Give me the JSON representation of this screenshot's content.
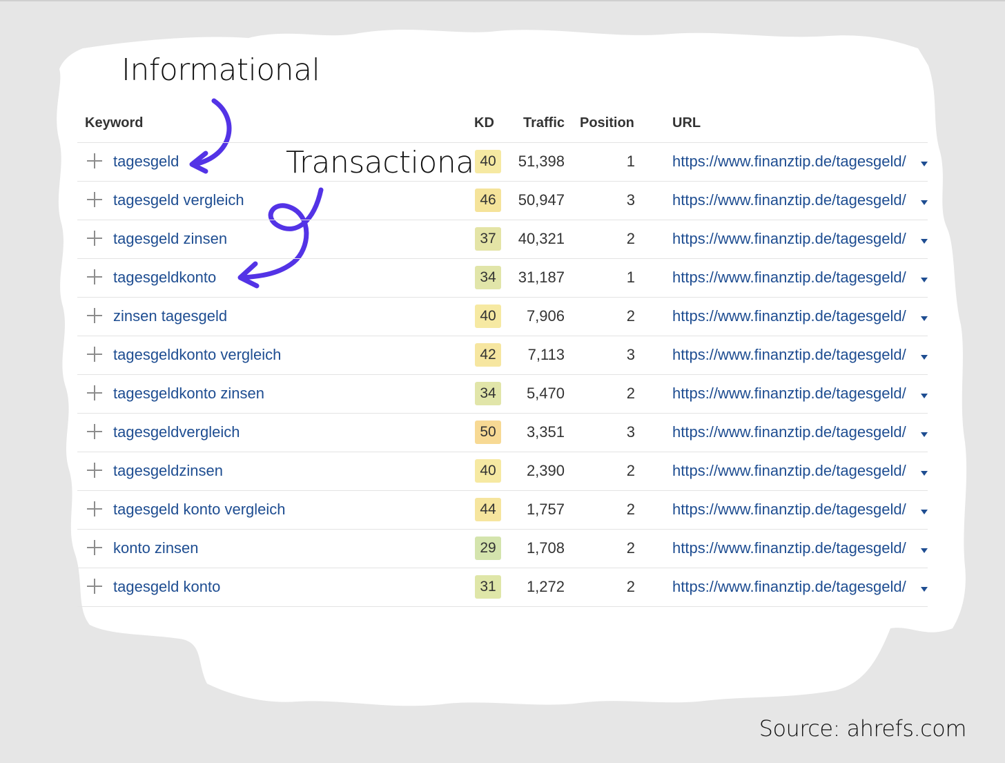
{
  "annotations": {
    "informational": "Informational",
    "transactional": "Transactional",
    "arrow_color": "#5333e6"
  },
  "table": {
    "headers": {
      "keyword": "Keyword",
      "kd": "KD",
      "traffic": "Traffic",
      "position": "Position",
      "url": "URL"
    },
    "rows": [
      {
        "keyword": "tagesgeld",
        "kd": "40",
        "kd_color": "#f6e9a2",
        "traffic": "51,398",
        "position": "1",
        "url": "https://www.finanztip.de/tagesgeld/"
      },
      {
        "keyword": "tagesgeld vergleich",
        "kd": "46",
        "kd_color": "#f5e39a",
        "traffic": "50,947",
        "position": "3",
        "url": "https://www.finanztip.de/tagesgeld/"
      },
      {
        "keyword": "tagesgeld zinsen",
        "kd": "37",
        "kd_color": "#e4e4a6",
        "traffic": "40,321",
        "position": "2",
        "url": "https://www.finanztip.de/tagesgeld/"
      },
      {
        "keyword": "tagesgeldkonto",
        "kd": "34",
        "kd_color": "#e1e5a9",
        "traffic": "31,187",
        "position": "1",
        "url": "https://www.finanztip.de/tagesgeld/"
      },
      {
        "keyword": "zinsen tagesgeld",
        "kd": "40",
        "kd_color": "#f6e9a2",
        "traffic": "7,906",
        "position": "2",
        "url": "https://www.finanztip.de/tagesgeld/"
      },
      {
        "keyword": "tagesgeldkonto vergleich",
        "kd": "42",
        "kd_color": "#f6e6a0",
        "traffic": "7,113",
        "position": "3",
        "url": "https://www.finanztip.de/tagesgeld/"
      },
      {
        "keyword": "tagesgeldkonto zinsen",
        "kd": "34",
        "kd_color": "#e1e5a9",
        "traffic": "5,470",
        "position": "2",
        "url": "https://www.finanztip.de/tagesgeld/"
      },
      {
        "keyword": "tagesgeldvergleich",
        "kd": "50",
        "kd_color": "#f7d994",
        "traffic": "3,351",
        "position": "3",
        "url": "https://www.finanztip.de/tagesgeld/"
      },
      {
        "keyword": "tagesgeldzinsen",
        "kd": "40",
        "kd_color": "#f6e9a2",
        "traffic": "2,390",
        "position": "2",
        "url": "https://www.finanztip.de/tagesgeld/"
      },
      {
        "keyword": "tagesgeld konto vergleich",
        "kd": "44",
        "kd_color": "#f6e59e",
        "traffic": "1,757",
        "position": "2",
        "url": "https://www.finanztip.de/tagesgeld/"
      },
      {
        "keyword": "konto zinsen",
        "kd": "29",
        "kd_color": "#d4e4ad",
        "traffic": "1,708",
        "position": "2",
        "url": "https://www.finanztip.de/tagesgeld/"
      },
      {
        "keyword": "tagesgeld konto",
        "kd": "31",
        "kd_color": "#dfe6a8",
        "traffic": "1,272",
        "position": "2",
        "url": "https://www.finanztip.de/tagesgeld/"
      }
    ]
  },
  "source": "Source: ahrefs.com"
}
